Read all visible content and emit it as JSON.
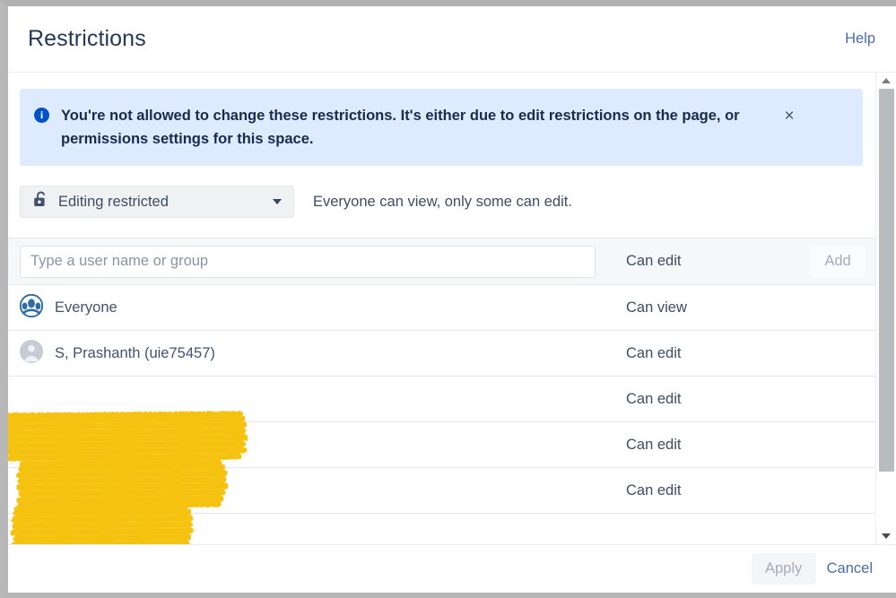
{
  "dialog": {
    "title": "Restrictions",
    "help_label": "Help"
  },
  "banner": {
    "icon": "info-circle-icon",
    "message": "You're not allowed to change these restrictions. It's either due to edit restrictions on the page, or permissions settings for this space.",
    "close_label": "×",
    "background": "#deebff",
    "icon_color": "#0052cc"
  },
  "mode": {
    "icon": "unlocked-padlock-icon",
    "selected": "Editing restricted",
    "caret": "chevron-down-icon",
    "description": "Everyone can view, only some can edit."
  },
  "search": {
    "placeholder": "Type a user name or group",
    "value": "",
    "permission": "Can edit",
    "add_label": "Add"
  },
  "rows": [
    {
      "avatar": "group-avatar-icon",
      "name": "Everyone",
      "permission": "Can view",
      "redacted": false
    },
    {
      "avatar": "person-avatar-icon",
      "name": "S, Prashanth (uie75457)",
      "permission": "Can edit",
      "redacted": false
    },
    {
      "avatar": "",
      "name": "",
      "permission": "Can edit",
      "redacted": true
    },
    {
      "avatar": "",
      "name": "",
      "permission": "Can edit",
      "redacted": true
    },
    {
      "avatar": "",
      "name": "",
      "permission": "Can edit",
      "redacted": true
    }
  ],
  "scrollbar": {
    "up_arrow": "triangle-up-icon",
    "down_arrow": "triangle-down-icon"
  },
  "footer": {
    "apply_label": "Apply",
    "cancel_label": "Cancel"
  },
  "colors": {
    "accent_link": "#4b6daa",
    "title": "#253858",
    "banner_bg": "#deebff",
    "info_blue": "#0052cc",
    "highlighter_yellow": "#f5c20f",
    "row_border": "#e6e7eb"
  }
}
